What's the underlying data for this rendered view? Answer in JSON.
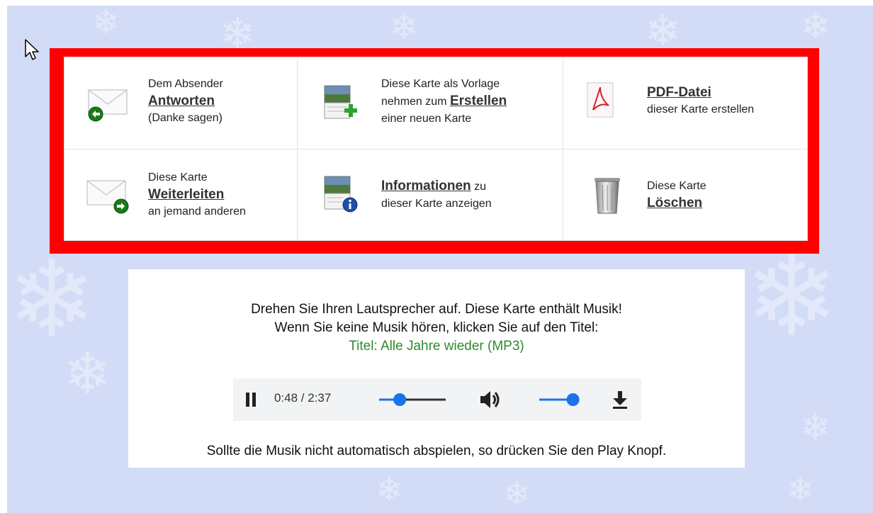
{
  "actions": {
    "reply": {
      "pre": "Dem Absender",
      "link": "Antworten",
      "post": "(Danke sagen)"
    },
    "template": {
      "pre": "Diese Karte als Vorlage",
      "mid": "nehmen zum ",
      "link": "Erstellen",
      "post": "einer neuen Karte"
    },
    "pdf": {
      "link": "PDF-Datei",
      "post": "dieser Karte erstellen"
    },
    "forward": {
      "pre": "Diese Karte",
      "link": "Weiterleiten",
      "post": "an jemand anderen"
    },
    "info": {
      "link": "Informationen",
      "suffix": " zu",
      "post": "dieser Karte anzeigen"
    },
    "delete": {
      "pre": "Diese Karte",
      "link": "Löschen"
    }
  },
  "music": {
    "line1": "Drehen Sie Ihren Lautsprecher auf. Diese Karte enthält Musik!",
    "line2": "Wenn Sie keine Musik hören, klicken Sie auf den Titel:",
    "title_link": "Titel: Alle Jahre wieder (MP3)",
    "footer": "Sollte die Musik nicht automatisch abspielen, so drücken Sie den Play Knopf."
  },
  "player": {
    "time": "0:48 / 2:37",
    "progress_fraction": 0.31,
    "volume_fraction": 0.85
  },
  "icons": [
    "cursor-icon",
    "reply-envelope-icon",
    "create-card-icon",
    "pdf-icon",
    "forward-envelope-icon",
    "info-card-icon",
    "trash-can-icon",
    "pause-icon",
    "volume-icon",
    "download-icon",
    "snowflake-icon"
  ],
  "colors": {
    "frame": "#ff0000",
    "background": "#d3dcf6",
    "title_link": "#2e8b2e",
    "player_accent": "#1a73e8"
  }
}
